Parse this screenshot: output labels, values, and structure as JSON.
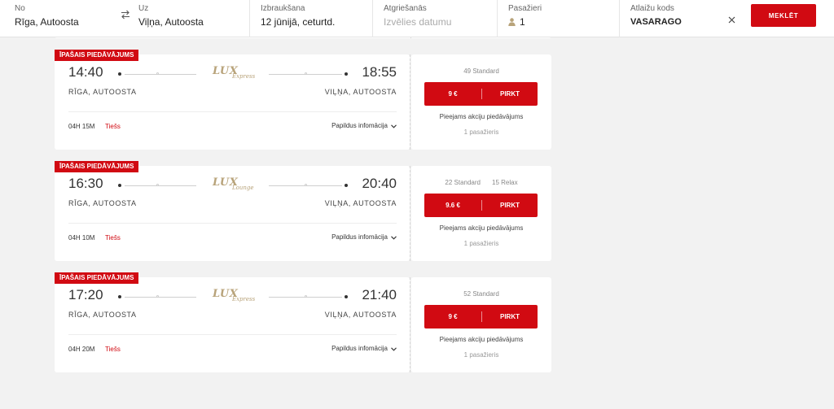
{
  "search": {
    "from": {
      "label": "No",
      "value": "Rīga, Autoosta"
    },
    "to": {
      "label": "Uz",
      "value": "Viļņa, Autoosta"
    },
    "departure": {
      "label": "Izbraukšana",
      "value": "12 jūnijā, ceturtd."
    },
    "return": {
      "label": "Atgriešanās",
      "placeholder": "Izvēlies datumu"
    },
    "passengers": {
      "label": "Pasažieri",
      "value": "1"
    },
    "promo": {
      "label": "Atlaižu kods",
      "value": "VASARAGO"
    },
    "button": "MEKLĒT"
  },
  "icons": {
    "swap": "swap-icon",
    "clear": "close-icon",
    "person": "person-icon",
    "expand": "chevron-down-icon"
  },
  "colors": {
    "accent": "#d10a12",
    "background": "#f2f2f2",
    "card": "#ffffff"
  },
  "trips": [
    {
      "badge": "ĪPAŠAIS PIEDĀVĀJUMS",
      "dep_time": "14:40",
      "arr_time": "18:55",
      "dep_place": "RĪGA, AUTOOSTA",
      "arr_place": "VIĻŅA, AUTOOSTA",
      "logo_main": "LUX",
      "logo_sub": "Express",
      "duration": "04H 15M",
      "direct": "Tiešs",
      "more": "Papildus infomācija",
      "seats": [
        "49 Standard"
      ],
      "price": "9 €",
      "buy": "PIRKT",
      "promo": "Pieejams akciju piedāvājums",
      "pax": "1 pasažieris"
    },
    {
      "badge": "ĪPAŠAIS PIEDĀVĀJUMS",
      "dep_time": "16:30",
      "arr_time": "20:40",
      "dep_place": "RĪGA, AUTOOSTA",
      "arr_place": "VIĻŅA, AUTOOSTA",
      "logo_main": "LUX",
      "logo_sub": "Lounge",
      "duration": "04H 10M",
      "direct": "Tiešs",
      "more": "Papildus infomācija",
      "seats": [
        "22 Standard",
        "15 Relax"
      ],
      "price": "9.6 €",
      "buy": "PIRKT",
      "promo": "Pieejams akciju piedāvājums",
      "pax": "1 pasažieris"
    },
    {
      "badge": "ĪPAŠAIS PIEDĀVĀJUMS",
      "dep_time": "17:20",
      "arr_time": "21:40",
      "dep_place": "RĪGA, AUTOOSTA",
      "arr_place": "VIĻŅA, AUTOOSTA",
      "logo_main": "LUX",
      "logo_sub": "Express",
      "duration": "04H 20M",
      "direct": "Tiešs",
      "more": "Papildus infomācija",
      "seats": [
        "52 Standard"
      ],
      "price": "9 €",
      "buy": "PIRKT",
      "promo": "Pieejams akciju piedāvājums",
      "pax": "1 pasažieris"
    }
  ]
}
